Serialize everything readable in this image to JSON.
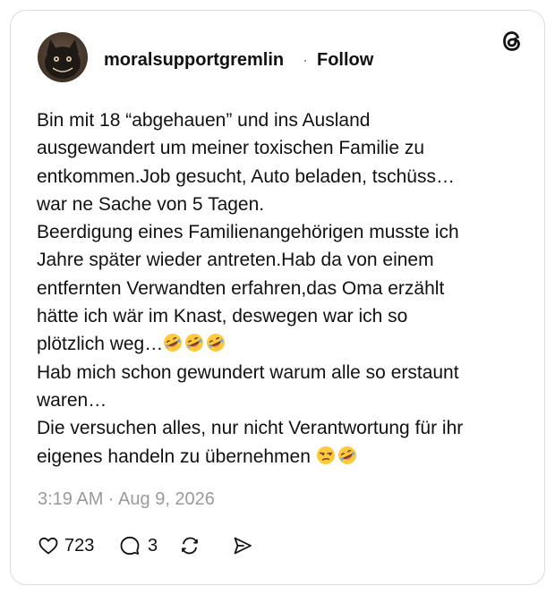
{
  "post": {
    "username": "moralsupportgremlin",
    "separator": "·",
    "follow_label": "Follow",
    "text_lines": [
      "Bin mit 18 “abgehauen” und ins Ausland",
      "ausgewandert um meiner toxischen Familie zu",
      "entkommen.Job gesucht, Auto beladen, tschüss…",
      "war ne Sache von 5 Tagen.",
      "Beerdigung eines Familienangehörigen musste ich",
      "Jahre später wieder antreten.Hab da von einem",
      "entfernten Verwandten erfahren,das Oma erzählt",
      "hätte ich wär im Knast, deswegen war ich so",
      "plötzlich weg…",
      "Hab mich schon gewundert warum alle so erstaunt",
      "waren…",
      "Die versuchen alles, nur nicht Verantwortung für ihr",
      "eigenes handeln zu übernehmen "
    ],
    "timestamp": "3:19 AM · Aug 9, 2026",
    "likes": "723",
    "replies": "3"
  },
  "icons": {
    "logo": "threads-logo-icon",
    "like": "heart-icon",
    "reply": "comment-bubble-icon",
    "repost": "repost-icon",
    "share": "send-icon",
    "emoji_rofl": "rolling-laughing-emoji-icon",
    "emoji_unamused": "unamused-face-emoji-icon"
  },
  "colors": {
    "text": "#111111",
    "muted": "#9a9a9a",
    "border": "#dcdcdc",
    "emoji_yellow": "#ffc83d"
  }
}
